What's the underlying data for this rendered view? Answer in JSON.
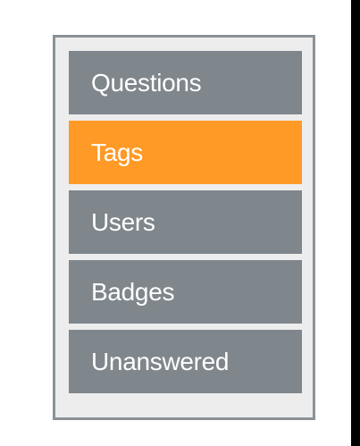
{
  "colors": {
    "outer_background": "#000000",
    "page_background": "#ffffff",
    "panel_background": "#ededed",
    "panel_border": "#8a9297",
    "item_background": "#7f868c",
    "item_active_background": "#ff9a27",
    "item_text": "#ffffff"
  },
  "nav": {
    "items": [
      {
        "label": "Questions",
        "active": false
      },
      {
        "label": "Tags",
        "active": true
      },
      {
        "label": "Users",
        "active": false
      },
      {
        "label": "Badges",
        "active": false
      },
      {
        "label": "Unanswered",
        "active": false
      }
    ]
  }
}
